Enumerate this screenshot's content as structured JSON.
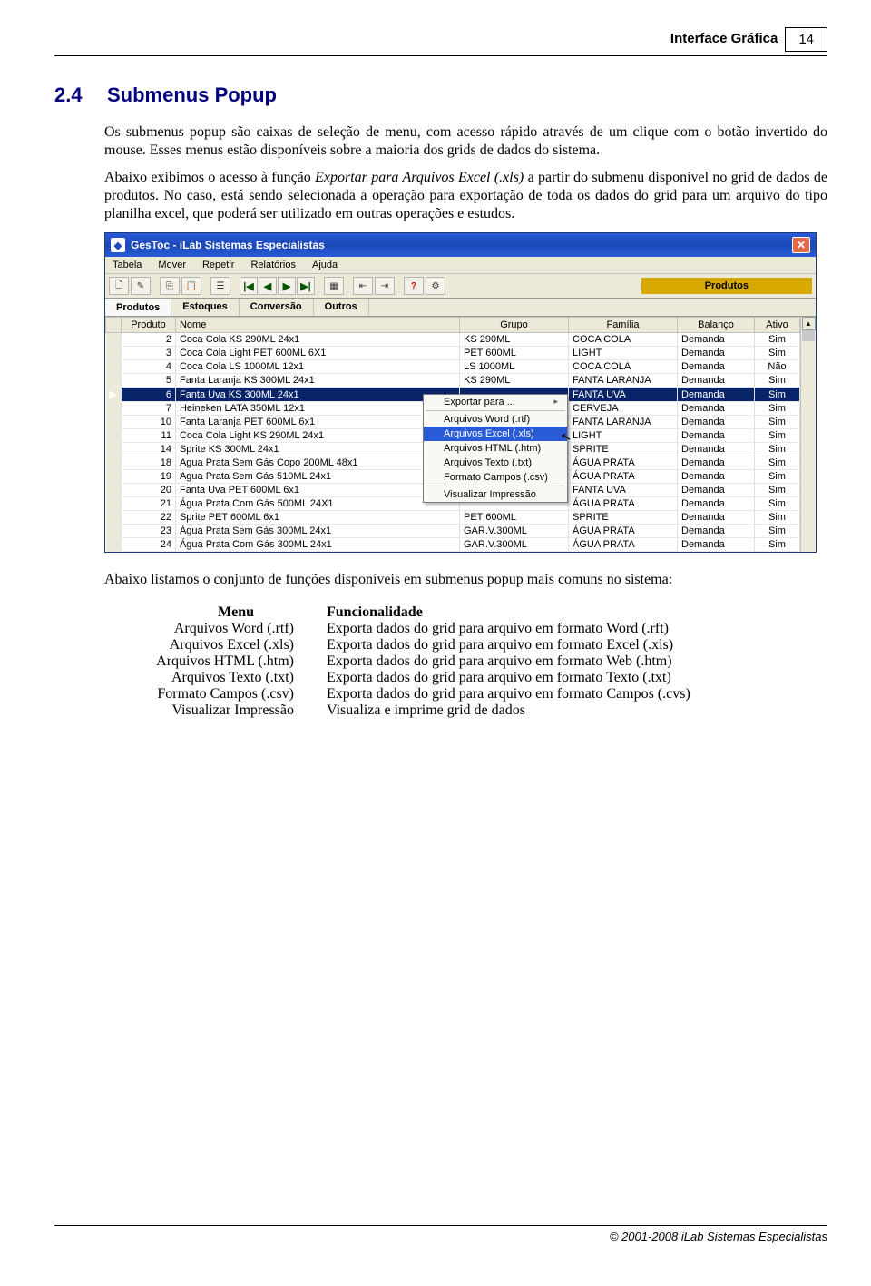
{
  "header": {
    "title": "Interface Gráfica",
    "page": "14"
  },
  "section": {
    "num": "2.4",
    "title": "Submenus Popup"
  },
  "para1": "Os submenus popup são caixas de seleção de menu, com acesso rápido através de um clique com o botão invertido do mouse. Esses menus estão disponíveis sobre a maioria dos grids de dados do sistema.",
  "para2a": "Abaixo exibimos o acesso à função ",
  "para2b": "Exportar para Arquivos Excel (.xls)",
  "para2c": " a partir do submenu disponível no grid de dados de produtos. No caso, está sendo selecionada a operação para exportação de toda os dados do grid para um arquivo do tipo planilha excel, que poderá ser utilizado em outras operações e estudos.",
  "app": {
    "title": "GesToc - iLab Sistemas Especialistas",
    "menus": [
      "Tabela",
      "Mover",
      "Repetir",
      "Relatórios",
      "Ajuda"
    ],
    "right_label": "Produtos",
    "tabs": [
      "Produtos",
      "Estoques",
      "Conversão",
      "Outros"
    ],
    "columns": [
      "Produto",
      "Nome",
      "Grupo",
      "Família",
      "Balanço",
      "Ativo"
    ],
    "rows": [
      {
        "p": "2",
        "n": "Coca Cola KS 290ML 24x1",
        "g": "KS 290ML",
        "f": "COCA COLA",
        "b": "Demanda",
        "a": "Sim"
      },
      {
        "p": "3",
        "n": "Coca Cola Light PET 600ML 6X1",
        "g": "PET 600ML",
        "f": "LIGHT",
        "b": "Demanda",
        "a": "Sim"
      },
      {
        "p": "4",
        "n": "Coca Cola LS 1000ML 12x1",
        "g": "LS 1000ML",
        "f": "COCA COLA",
        "b": "Demanda",
        "a": "Não"
      },
      {
        "p": "5",
        "n": "Fanta Laranja KS 300ML 24x1",
        "g": "KS 290ML",
        "f": "FANTA LARANJA",
        "b": "Demanda",
        "a": "Sim"
      },
      {
        "p": "6",
        "n": "Fanta Uva KS 300ML 24x1",
        "g": "",
        "f": "FANTA UVA",
        "b": "Demanda",
        "a": "Sim",
        "sel": true
      },
      {
        "p": "7",
        "n": "Heineken LATA 350ML 12x1",
        "g": "",
        "f": "CERVEJA",
        "b": "Demanda",
        "a": "Sim"
      },
      {
        "p": "10",
        "n": "Fanta Laranja PET 600ML 6x1",
        "g": "",
        "f": "FANTA LARANJA",
        "b": "Demanda",
        "a": "Sim"
      },
      {
        "p": "11",
        "n": "Coca Cola Light KS 290ML 24x1",
        "g": "",
        "f": "LIGHT",
        "b": "Demanda",
        "a": "Sim"
      },
      {
        "p": "14",
        "n": "Sprite KS 300ML 24x1",
        "g": "",
        "f": "SPRITE",
        "b": "Demanda",
        "a": "Sim"
      },
      {
        "p": "18",
        "n": "Agua Prata Sem Gás Copo 200ML 48x1",
        "g": "",
        "f": "ÁGUA PRATA",
        "b": "Demanda",
        "a": "Sim"
      },
      {
        "p": "19",
        "n": "Agua Prata Sem Gás 510ML 24x1",
        "g": "",
        "f": "ÁGUA PRATA",
        "b": "Demanda",
        "a": "Sim"
      },
      {
        "p": "20",
        "n": "Fanta Uva PET 600ML 6x1",
        "g": "",
        "f": "FANTA UVA",
        "b": "Demanda",
        "a": "Sim"
      },
      {
        "p": "21",
        "n": "Água Prata Com Gás 500ML 24X1",
        "g": "",
        "f": "ÁGUA PRATA",
        "b": "Demanda",
        "a": "Sim"
      },
      {
        "p": "22",
        "n": "Sprite PET 600ML 6x1",
        "g": "PET 600ML",
        "f": "SPRITE",
        "b": "Demanda",
        "a": "Sim"
      },
      {
        "p": "23",
        "n": "Água Prata Sem Gás 300ML 24x1",
        "g": "GAR.V.300ML",
        "f": "ÁGUA PRATA",
        "b": "Demanda",
        "a": "Sim"
      },
      {
        "p": "24",
        "n": "Água Prata Com Gás 300ML 24x1",
        "g": "GAR.V.300ML",
        "f": "ÁGUA PRATA",
        "b": "Demanda",
        "a": "Sim"
      }
    ],
    "popup": {
      "header": "Exportar para ...",
      "items": [
        "Arquivos Word (.rtf)",
        "Arquivos Excel (.xls)",
        "Arquivos HTML (.htm)",
        "Arquivos Texto (.txt)",
        "Formato Campos (.csv)"
      ],
      "footer": "Visualizar Impressão",
      "highlight_index": 1
    }
  },
  "caption": "Abaixo listamos o conjunto de funções disponíveis em submenus popup mais comuns no sistema:",
  "func": {
    "h_menu": "Menu",
    "h_func": "Funcionalidade",
    "rows": [
      {
        "m": "Arquivos Word (.rtf)",
        "f": "Exporta dados do grid para arquivo em formato Word (.rft)"
      },
      {
        "m": "Arquivos Excel (.xls)",
        "f": "Exporta dados do grid para arquivo em formato Excel (.xls)"
      },
      {
        "m": "Arquivos HTML (.htm)",
        "f": "Exporta dados do grid para arquivo em formato Web (.htm)"
      },
      {
        "m": "Arquivos Texto (.txt)",
        "f": "Exporta dados do grid para arquivo em formato Texto (.txt)"
      },
      {
        "m": "Formato Campos (.csv)",
        "f": "Exporta dados do grid para arquivo em formato Campos (.cvs)"
      },
      {
        "m": "Visualizar Impressão",
        "f": "Visualiza e imprime grid de dados"
      }
    ]
  },
  "footer": "© 2001-2008 iLab Sistemas Especialistas"
}
